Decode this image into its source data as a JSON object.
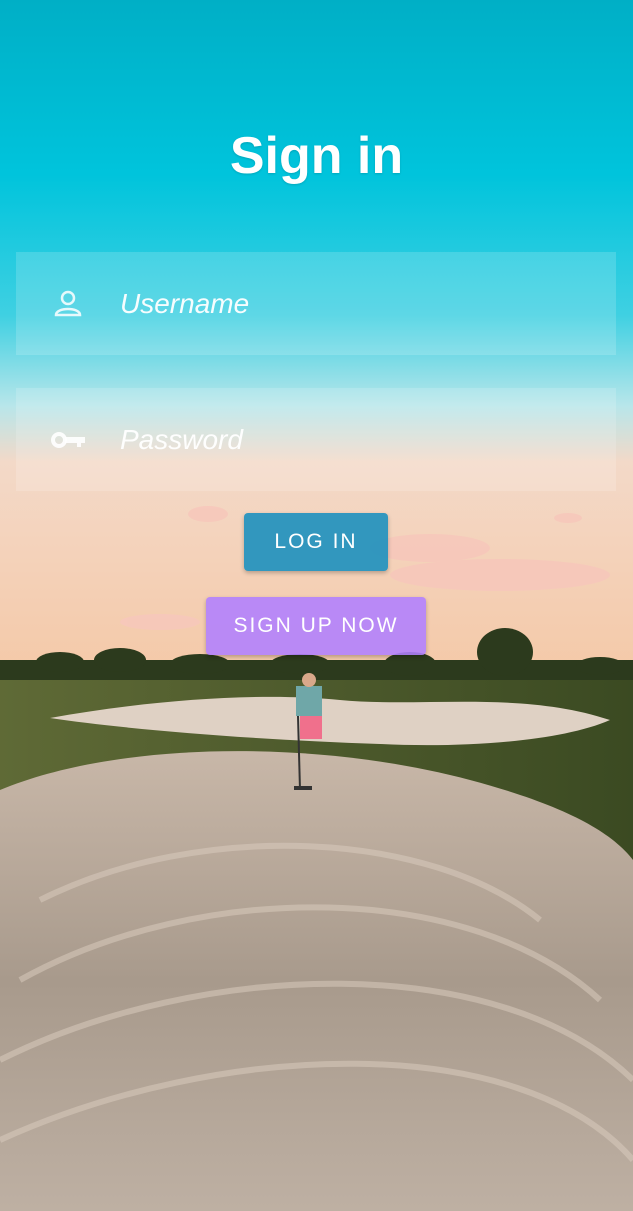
{
  "header": {
    "title": "Sign in"
  },
  "form": {
    "username": {
      "placeholder": "Username",
      "value": "",
      "icon": "person-icon"
    },
    "password": {
      "placeholder": "Password",
      "value": "",
      "icon": "key-icon"
    }
  },
  "actions": {
    "login_label": "LOG IN",
    "signup_label": "SIGN UP NOW"
  },
  "colors": {
    "sky_top": "#00B8D0",
    "login_button": "#1B8EBE",
    "signup_button": "#B180FF",
    "text": "#FFFFFF"
  }
}
